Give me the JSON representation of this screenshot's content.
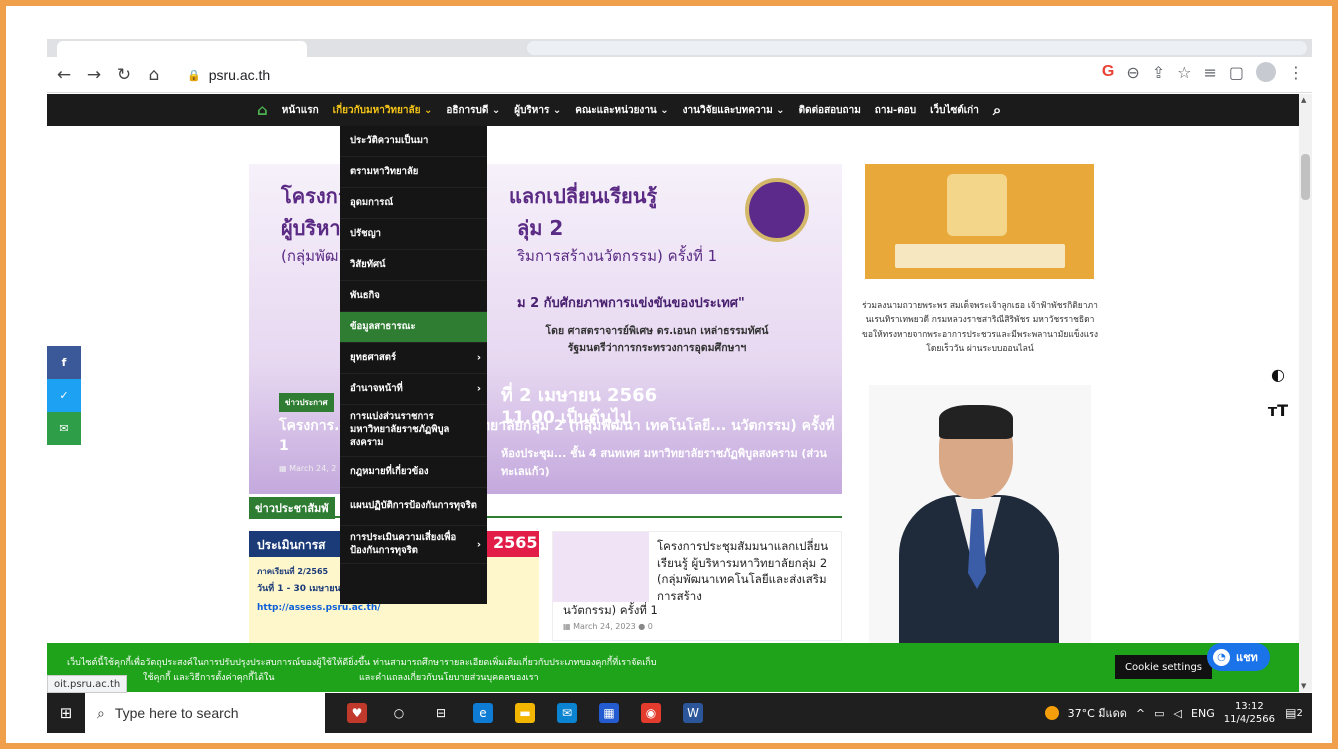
{
  "browser": {
    "url": "psru.ac.th",
    "status_url": "oit.psru.ac.th",
    "icons": [
      "back-icon",
      "forward-icon",
      "reload-icon",
      "home-icon",
      "google-icon",
      "zoom-icon",
      "share-icon",
      "star-icon",
      "reading-list-icon",
      "side-panel-icon",
      "profile-icon",
      "menu-icon"
    ]
  },
  "nav": {
    "items": [
      {
        "label": "หน้าแรก"
      },
      {
        "label": "เกี่ยวกับมหาวิทยาลัย ⌄"
      },
      {
        "label": "อธิการบดี ⌄"
      },
      {
        "label": "ผู้บริหาร ⌄"
      },
      {
        "label": "คณะและหน่วยงาน ⌄"
      },
      {
        "label": "งานวิจัยและบทความ ⌄"
      },
      {
        "label": "ติดต่อสอบถาม"
      },
      {
        "label": "ถาม-ตอบ"
      },
      {
        "label": "เว็บไซต์เก่า"
      }
    ]
  },
  "dropdown": {
    "items": [
      {
        "label": "ประวัติความเป็นมา"
      },
      {
        "label": "ตรามหาวิทยาลัย"
      },
      {
        "label": "อุดมการณ์"
      },
      {
        "label": "ปรัชญา"
      },
      {
        "label": "วิสัยทัศน์"
      },
      {
        "label": "พันธกิจ"
      },
      {
        "label": "ข้อมูลสาธารณะ"
      },
      {
        "label": "ยุทธศาสตร์"
      },
      {
        "label": "อำนาจหน้าที่"
      },
      {
        "label": "การแบ่งส่วนราชการมหาวิทยาลัยราชภัฏพิบูลสงคราม"
      },
      {
        "label": "กฎหมายที่เกี่ยวข้อง"
      },
      {
        "label": "แผนปฏิบัติการป้องกันการทุจริต"
      },
      {
        "label": "การประเมินความเสี่ยงเพื่อป้องกันการทุจริต"
      }
    ]
  },
  "banner": {
    "line1_left": "โครงกา",
    "line1_right": "แลกเปลี่ยนเรียนรู้",
    "line2_left": "ผู้บริหา",
    "line2_right": "ลุ่ม 2",
    "line3_left": "(กลุ่มพัฒ",
    "line3_right": "ริมการสร้างนวัตกรรม) ครั้งที่ 1",
    "quote": "ม 2 กับศักยภาพการแข่งขันของประเทศ\"",
    "by": "โดย ศาสตราจารย์พิเศษ ดร.เอนก เหล่าธรรมทัศน์",
    "by2": "รัฐมนตรีว่าการกระทรวงการอุดมศึกษาฯ",
    "date": "ที่ 2 เมษายน 2566",
    "time": "11.00 เป็นต้นไป",
    "tag": "ข่าวประกาศ",
    "title": "โครงการ... เรียนรู้ ผู้บริหารมหาวิทยาลัยกลุ่ม 2 (กลุ่มพัฒนา เทคโนโลยี... นวัตกรรม) ครั้งที่ 1",
    "venue": "ห้องประชุม... ชั้น 4 สนทเทศ มหาวิทยาลัยราชภัฏพิบูลสงคราม (ส่วนทะเลแก้ว)",
    "meta": "March 24, 2"
  },
  "section_label": "ข่าวประชาสัมพั",
  "ad": {
    "top": "ประเมินการส",
    "year": "2565",
    "line1": "ภาคเรียนที่ 2/2565",
    "line2": "วันที่ 1 - 30 เมษายน",
    "line3": "http://assess.psru.ac.th/"
  },
  "card": {
    "title": "โครงการประชุมสัมมนาแลกเปลี่ยนเรียนรู้ ผู้บริหารมหาวิทยาลัยกลุ่ม 2 (กลุ่มพัฒนาเทคโนโลยีและส่งเสริมการสร้าง",
    "title2": "นวัตกรรม) ครั้งที่ 1",
    "date": "March 24, 2023",
    "comments": "0"
  },
  "side_text": "ร่วมลงนามถวายพระพร สมเด็จพระเจ้าลูกเธอ เจ้าฟ้าพัชรกิติยาภา นเรนทิราเทพยวดี กรมหลวงราชสาริณีสิริพัชร มหาวัชรราชธิดา ขอให้ทรงหายจากพระอาการประชวรและมีพระพลานามัยแข็งแรงโดยเร็ววัน ผ่านระบบออนไลน์",
  "social": [
    {
      "label": "f",
      "color": "#3b5998"
    },
    {
      "label": "✓",
      "color": "#1da1f2"
    },
    {
      "label": "✉",
      "color": "#2e9e49"
    }
  ],
  "tools": [
    "◐",
    "тT"
  ],
  "cookie": {
    "line1": "เว็บไซต์นี้ใช้คุกกี้เพื่อวัตถุประสงค์ในการปรับปรุงประสบการณ์ของผู้ใช้ให้ดียิ่งขึ้น ท่านสามารถศึกษารายละเอียดเพิ่มเติมเกี่ยวกับประเภทของคุกกี้ที่เราจัดเก็บ",
    "line2": "ใช้คุกกี้ และวิธีการตั้งค่าคุกกี้ได้ใน",
    "line3": "และคำแถลงเกี่ยวกับนโยบายส่วนบุคคลของเรา",
    "settings": "Cookie settings",
    "chat": "แชท"
  },
  "taskbar": {
    "search": "Type here to search",
    "weather": "37°C มีแดด",
    "lang": "ENG",
    "time": "13:12",
    "date": "11/4/2566",
    "notifications": "2"
  },
  "colors": {
    "frame": "#f0a04b",
    "nav_bg": "#1b1b1b",
    "accent_green": "#2e7d32",
    "cookie_bg": "#1fa31a",
    "chat_blue": "#1a73e8"
  }
}
